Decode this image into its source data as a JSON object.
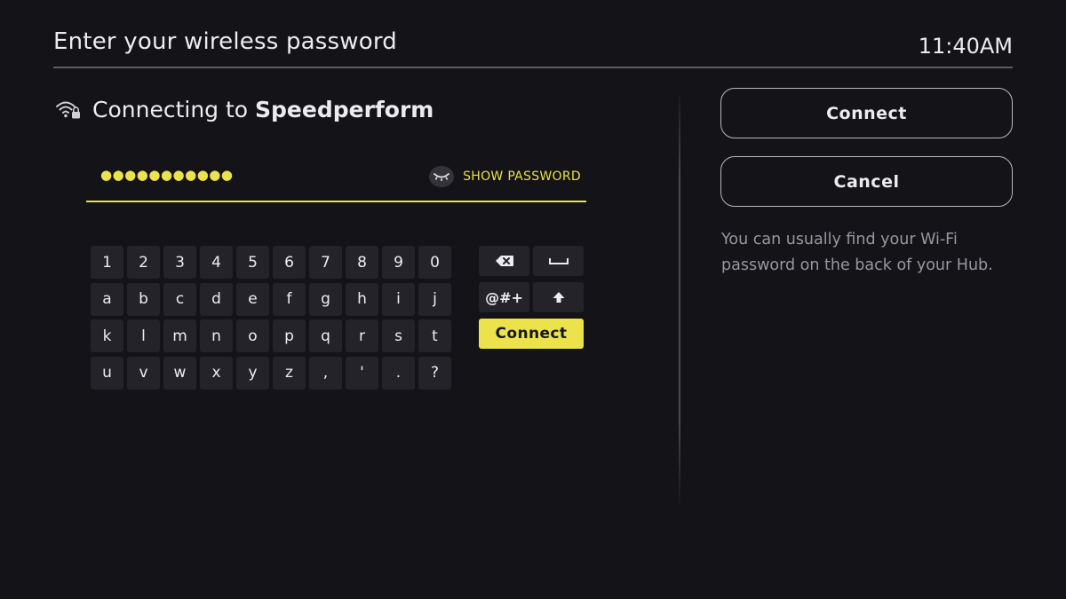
{
  "header": {
    "title": "Enter your wireless password",
    "time": "11:40AM"
  },
  "network": {
    "prefix": "Connecting to",
    "name": "Speedperform",
    "icon": "wifi-lock-icon"
  },
  "password": {
    "masked_value": "●●●●●●●●●●●",
    "show_label": "SHOW PASSWORD",
    "show_icon": "closed-eye-icon"
  },
  "keyboard": {
    "rows": [
      [
        "1",
        "2",
        "3",
        "4",
        "5",
        "6",
        "7",
        "8",
        "9",
        "0"
      ],
      [
        "a",
        "b",
        "c",
        "d",
        "e",
        "f",
        "g",
        "h",
        "i",
        "j"
      ],
      [
        "k",
        "l",
        "m",
        "n",
        "o",
        "p",
        "q",
        "r",
        "s",
        "t"
      ],
      [
        "u",
        "v",
        "w",
        "x",
        "y",
        "z",
        ",",
        "'",
        ".",
        "?"
      ]
    ],
    "symbols_label": "@#+",
    "connect_label": "Connect",
    "backspace_icon": "backspace-icon",
    "space_icon": "space-icon",
    "shift_icon": "shift-icon"
  },
  "actions": {
    "connect_label": "Connect",
    "cancel_label": "Cancel",
    "hint": "You can usually find your Wi-Fi password on the back of your Hub."
  },
  "colors": {
    "background": "#141318",
    "accent": "#ebe24c",
    "key": "#24232a"
  }
}
